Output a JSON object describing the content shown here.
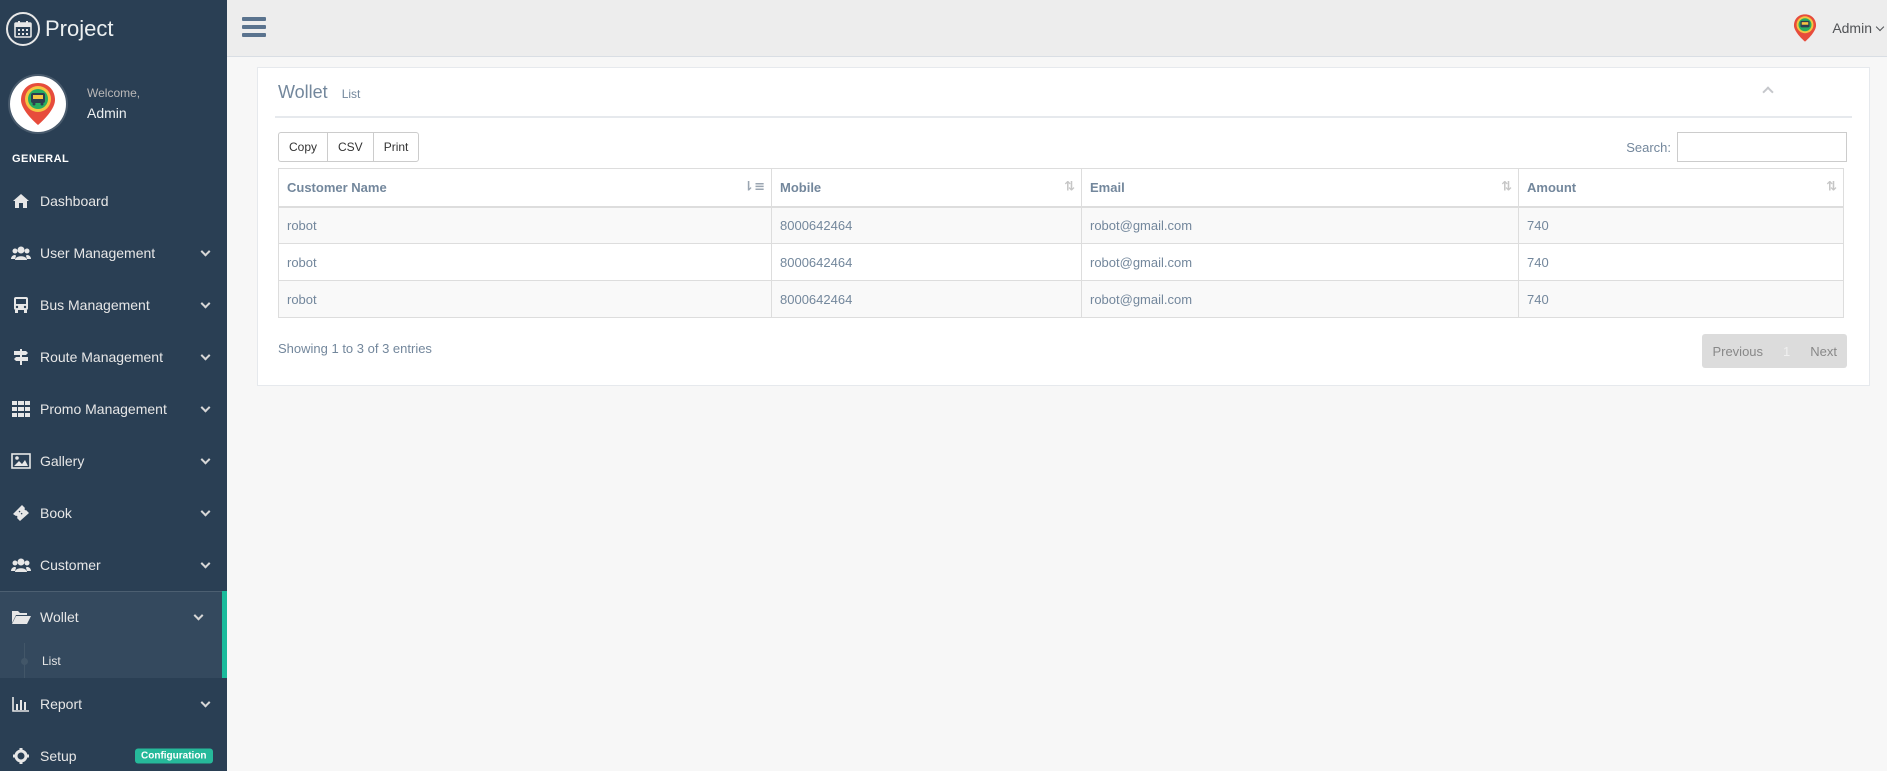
{
  "brand": {
    "title": "Project",
    "icon": "calendar-icon"
  },
  "profile": {
    "welcome": "Welcome,",
    "name": "Admin"
  },
  "sidebar": {
    "section": "GENERAL",
    "items": [
      {
        "label": "Dashboard",
        "icon": "home-icon"
      },
      {
        "label": "User Management",
        "icon": "users-icon"
      },
      {
        "label": "Bus Management",
        "icon": "bus-icon"
      },
      {
        "label": "Route Management",
        "icon": "signpost-icon"
      },
      {
        "label": "Promo Management",
        "icon": "grid-icon"
      },
      {
        "label": "Gallery",
        "icon": "image-icon"
      },
      {
        "label": "Book",
        "icon": "ticket-icon"
      },
      {
        "label": "Customer",
        "icon": "users-icon"
      },
      {
        "label": "Wollet",
        "icon": "folder-open-icon"
      },
      {
        "label": "Report",
        "icon": "bar-chart-icon"
      },
      {
        "label": "Setup",
        "icon": "gear-icon"
      }
    ],
    "wollet_sub": "List",
    "setup_badge": "Configuration"
  },
  "topnav": {
    "user": "Admin"
  },
  "panel": {
    "title": "Wollet",
    "subtitle": "List",
    "buttons": {
      "copy": "Copy",
      "csv": "CSV",
      "print": "Print"
    },
    "search_label": "Search:",
    "columns": [
      "Customer Name",
      "Mobile",
      "Email",
      "Amount"
    ],
    "rows": [
      [
        "robot",
        "8000642464",
        "robot@gmail.com",
        "740"
      ],
      [
        "robot",
        "8000642464",
        "robot@gmail.com",
        "740"
      ],
      [
        "robot",
        "8000642464",
        "robot@gmail.com",
        "740"
      ]
    ],
    "info": "Showing 1 to 3 of 3 entries",
    "pagination": {
      "previous": "Previous",
      "page": "1",
      "next": "Next"
    }
  },
  "colors": {
    "sidebar": "#2a3f54",
    "accent": "#1abb9c",
    "badge": "#26b99a"
  }
}
